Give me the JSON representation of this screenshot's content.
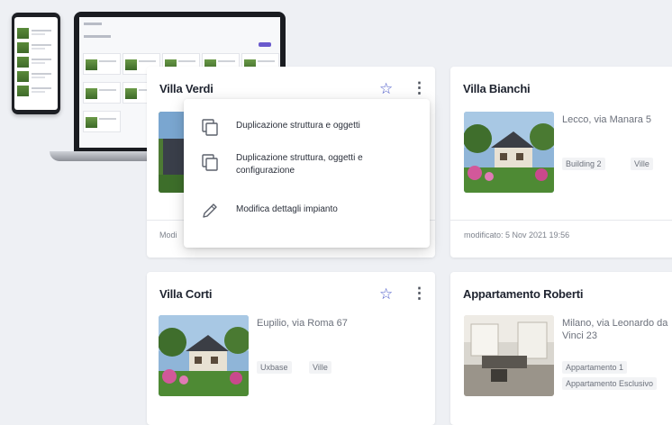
{
  "cards": [
    {
      "title": "Villa Verdi",
      "footer_partial": "Modi"
    },
    {
      "title": "Villa Bianchi",
      "address": "Lecco, via Manara 5",
      "tags": [
        "Building 2",
        "Ville"
      ],
      "footer": "modificato: 5 Nov 2021 19:56"
    },
    {
      "title": "Villa Corti",
      "address": "Eupilio, via Roma 67",
      "tags": [
        "Uxbase",
        "Ville"
      ]
    },
    {
      "title": "Appartamento Roberti",
      "address": "Milano, via Leonardo da Vinci 23",
      "tags": [
        "Appartamento 1",
        "Appartamento Esclusivo"
      ]
    }
  ],
  "menu": {
    "items": [
      {
        "label": "Duplicazione struttura e oggetti",
        "icon": "copy-icon"
      },
      {
        "label": "Duplicazione struttura, oggetti e configurazione",
        "icon": "copy-icon"
      },
      {
        "label": "Modifica dettagli impianto",
        "icon": "pencil-icon"
      }
    ]
  },
  "colors": {
    "accent": "#4a58c8",
    "background": "#eef0f4"
  }
}
